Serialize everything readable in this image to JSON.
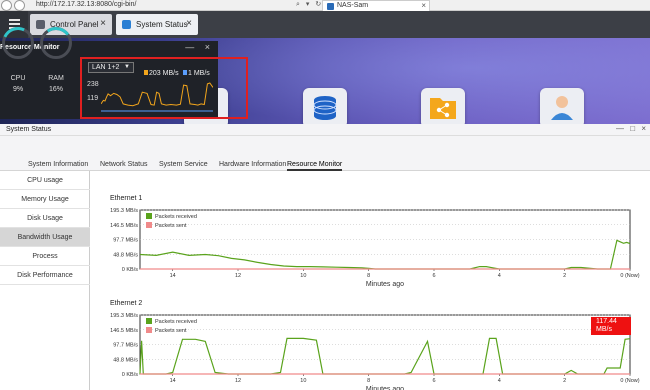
{
  "browser": {
    "url": "http://172.17.32.13:8080/cgi-bin/",
    "url_icons": "⌕ ▾ ↻",
    "tab_label": "NAS-Sam",
    "tab_close": "×"
  },
  "taskbar": {
    "tabs": [
      {
        "label": "Control Panel",
        "close": "×"
      },
      {
        "label": "System Status",
        "close": "×"
      }
    ]
  },
  "resource_monitor": {
    "title": "Resource Monitor",
    "controls": "— ×",
    "cpu": {
      "label": "CPU",
      "value": "9%"
    },
    "ram": {
      "label": "RAM",
      "value": "16%"
    },
    "interface": "LAN 1+2",
    "download_rate": "203 MB/s",
    "upload_rate": "1 MB/s",
    "y_ticks": [
      "238",
      "119"
    ],
    "colors": {
      "download": "#f2a51c",
      "upload": "#5a9dfc",
      "highlight_box": "#e02020"
    }
  },
  "window": {
    "title": "System Status",
    "controls": "— □ ×",
    "tabs": [
      "System Information",
      "Network Status",
      "System Service",
      "Hardware Information",
      "Resource Monitor"
    ],
    "sidebar": [
      "CPU usage",
      "Memory Usage",
      "Disk Usage",
      "Bandwidth Usage",
      "Process",
      "Disk Performance"
    ],
    "active_sidebar": "Bandwidth Usage"
  },
  "chart_data": [
    {
      "type": "line",
      "title": "Ethernet 1",
      "xlabel": "Minutes ago",
      "ylabel": "",
      "y_ticks": [
        "195.3 MB/s",
        "146.5 MB/s",
        "97.7 MB/s",
        "48.8 MB/s",
        "0 KB/s"
      ],
      "ylim": [
        0,
        195.3
      ],
      "x_ticks": [
        "14",
        "12",
        "10",
        "8",
        "6",
        "4",
        "2",
        "0 (Now)"
      ],
      "xlim": [
        15,
        0
      ],
      "legend": [
        "Packets received",
        "Packets sent"
      ],
      "legend_position": "top-left",
      "series": [
        {
          "name": "Packets received",
          "color": "#5aa31c",
          "x": [
            15,
            14.5,
            14,
            13.5,
            13,
            12.6,
            12.2,
            11.8,
            11.4,
            11,
            10.6,
            10.2,
            9.8,
            9.4,
            9,
            8.6,
            8.2,
            8,
            7.8,
            7,
            6,
            5,
            4.9,
            4.6,
            4.4,
            4.2,
            4,
            3.8,
            3,
            2.5,
            2,
            1.8,
            1.5,
            1,
            0.9,
            0.8,
            0.6,
            0.4,
            0.3,
            0.2,
            0.1,
            0
          ],
          "y": [
            48,
            45,
            56,
            45,
            48,
            44,
            35,
            30,
            22,
            15,
            10,
            8,
            8,
            7,
            6,
            5,
            4,
            2,
            0,
            0,
            0,
            0,
            0,
            8,
            8,
            4,
            0,
            0,
            0,
            0,
            0,
            5,
            5,
            0,
            0,
            0,
            0,
            95,
            90,
            85,
            88,
            84
          ]
        },
        {
          "name": "Packets sent",
          "color": "#f08a8a",
          "x": [
            15,
            0
          ],
          "y": [
            0,
            0
          ]
        }
      ]
    },
    {
      "type": "line",
      "title": "Ethernet 2",
      "xlabel": "Minutes ago",
      "ylabel": "",
      "y_ticks": [
        "195.3 MB/s",
        "146.5 MB/s",
        "97.7 MB/s",
        "48.8 MB/s",
        "0 KB/s"
      ],
      "ylim": [
        0,
        195.3
      ],
      "x_ticks": [
        "14",
        "12",
        "10",
        "8",
        "6",
        "4",
        "2",
        "0 (Now)"
      ],
      "xlim": [
        15,
        0
      ],
      "legend": [
        "Packets received",
        "Packets sent"
      ],
      "legend_position": "top-left",
      "tooltip": "117.44\nMB/s",
      "series": [
        {
          "name": "Packets received",
          "color": "#5aa31c",
          "x": [
            15,
            14.95,
            14.9,
            14.2,
            14,
            13.7,
            13.3,
            13,
            12.7,
            12.3,
            11,
            10.7,
            10.5,
            10,
            9.6,
            9.4,
            8,
            6.9,
            6.7,
            6.2,
            6,
            5,
            4.5,
            4.3,
            4.1,
            3.9,
            2,
            1.8,
            1.6,
            0.9,
            0.8,
            0.7,
            0.3,
            0.15,
            0
          ],
          "y": [
            0,
            110,
            0,
            0,
            5,
            115,
            115,
            108,
            5,
            0,
            0,
            5,
            118,
            118,
            112,
            0,
            0,
            0,
            5,
            108,
            0,
            0,
            0,
            118,
            118,
            0,
            0,
            12,
            0,
            0,
            0,
            20,
            20,
            115,
            117
          ]
        },
        {
          "name": "Packets sent",
          "color": "#f08a8a",
          "x": [
            15,
            0
          ],
          "y": [
            0,
            0
          ]
        }
      ]
    }
  ],
  "mini_chart": {
    "x": [
      0,
      3,
      5,
      7,
      9,
      12,
      16,
      20,
      24,
      28,
      34,
      40,
      47,
      52,
      58,
      63,
      67,
      70,
      73,
      76,
      82,
      88,
      95,
      100,
      104,
      108,
      112,
      118,
      122,
      126,
      130,
      134,
      137,
      141
    ],
    "y": [
      60,
      90,
      85,
      120,
      145,
      130,
      150,
      140,
      120,
      60,
      50,
      45,
      60,
      160,
      150,
      55,
      50,
      160,
      150,
      60,
      50,
      55,
      50,
      58,
      220,
      215,
      60,
      55,
      50,
      60,
      55,
      230,
      238,
      200
    ]
  }
}
